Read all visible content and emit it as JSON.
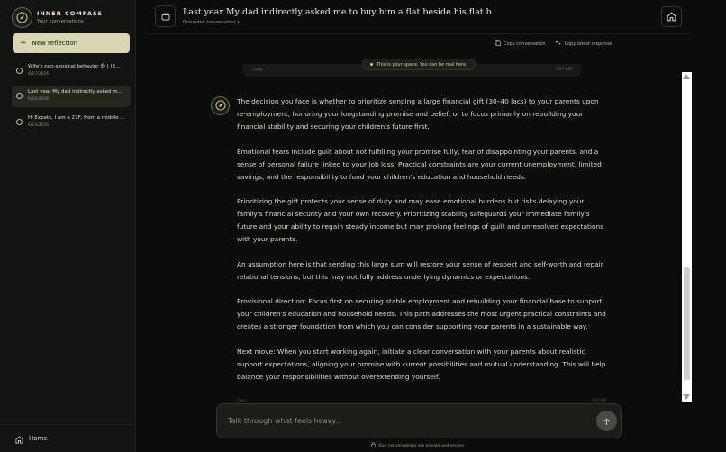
{
  "sidebar": {
    "brand_title": "INNER COMPASS",
    "brand_subtitle": "Your conversations",
    "new_button": "New reflection",
    "conversations": [
      {
        "title": "Wife's non-sensical behavior 😡 | (3...",
        "date": "6/27/2026"
      },
      {
        "title": "Last year My dad indirectly asked m...",
        "date": "6/24/2026"
      },
      {
        "title": "Hi Expats, I am a 27F, from a middle ...",
        "date": "6/23/2026"
      }
    ],
    "home_label": "Home"
  },
  "header": {
    "title": "Last year My dad indirectly asked me to buy him a flat beside his flat b",
    "subtitle": "Grounded conversation •"
  },
  "actions": {
    "copy_conversation": "Copy conversation",
    "copy_latest": "Copy latest response"
  },
  "toast": "This is your space. You can be real here.",
  "ghost": {
    "top_left": "Copy",
    "top_right": "7:07 AM",
    "bottom_left": "Copy",
    "bottom_right": "7:07 AM"
  },
  "message": {
    "paragraphs": [
      "The decision you face is whether to prioritize sending a large financial gift (30–40 lacs) to your parents upon re-employment, honoring your longstanding promise and belief, or to focus primarily on rebuilding your financial stability and securing your children's future first.",
      "Emotional fears include guilt about not fulfilling your promise fully, fear of disappointing your parents, and a sense of personal failure linked to your job loss. Practical constraints are your current unemployment, limited savings, and the responsibility to fund your children's education and household needs.",
      "Prioritizing the gift protects your sense of duty and may ease emotional burdens but risks delaying your family's financial security and your own recovery. Prioritizing stability safeguards your immediate family's future and your ability to regain steady income but may prolong feelings of guilt and unresolved expectations with your parents.",
      "An assumption here is that sending this large sum will restore your sense of respect and self-worth and repair relational tensions, but this may not fully address underlying dynamics or expectations.",
      "Provisional direction: Focus first on securing stable employment and rebuilding your financial base to support your children's education and household needs. This path addresses the most urgent practical constraints and creates a stronger foundation from which you can consider supporting your parents in a sustainable way.",
      "Next move: When you start working again, initiate a clear conversation with your parents about realistic support expectations, aligning your promise with current possibilities and mutual understanding. This will help balance your responsibilities without overextending yourself."
    ]
  },
  "composer": {
    "placeholder": "Talk through what feels heavy..."
  },
  "privacy_note": "Your conversations are private and secure",
  "colors": {
    "accent": "#d9d7b3",
    "background": "#0b0d0a",
    "sidebar": "#121411"
  }
}
